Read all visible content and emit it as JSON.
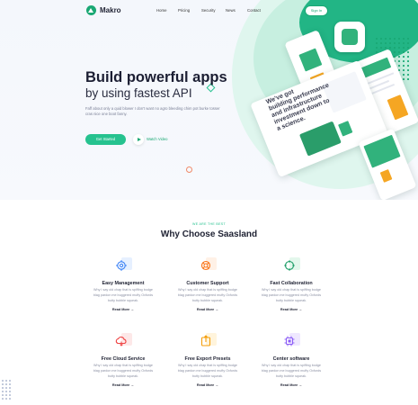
{
  "nav": {
    "logo": "Makro",
    "links": [
      "Home",
      "Pricing",
      "Security",
      "News",
      "Contact"
    ],
    "signin": "Sign In"
  },
  "hero": {
    "title": "Build powerful apps",
    "subtitle": "by using fastest API",
    "description": "Faff about only a quid blower I don't want no agro bleeding chim pot burke tosser cras nice one boot fanny.",
    "cta": "Get Started",
    "video_label": "Watch Video",
    "mockup_heading": "We've got building performance and infrastructure investment down to a science.",
    "phone_label": "Plants"
  },
  "section": {
    "eyebrow": "WE ARE THE BEST",
    "title": "Why Choose Saasland"
  },
  "features": [
    {
      "title": "Easy Management",
      "icon": "gear-icon",
      "color": "#3b82f6",
      "tint": "#e6f0ff",
      "desc": "Why I say old chap that is spiffing bodge blag pardon me buggered mufty Oxfords butty bubble squeak.",
      "link": "Read More"
    },
    {
      "title": "Customer Support",
      "icon": "lifebuoy-icon",
      "color": "#f97316",
      "tint": "#fff1e6",
      "desc": "Why I say old chap that is spiffing bodge blag pardon me buggered mufty Oxfords butty bubble squeak.",
      "link": "Read More"
    },
    {
      "title": "Fast Collaboration",
      "icon": "network-icon",
      "color": "#22a06b",
      "tint": "#e3f7ec",
      "desc": "Why I say old chap that is spiffing bodge blag pardon me buggered mufty Oxfords butty bubble squeak.",
      "link": "Read More"
    },
    {
      "title": "Free Cloud Service",
      "icon": "cloud-icon",
      "color": "#ef4444",
      "tint": "#fde8e8",
      "desc": "Why I say old chap that is spiffing bodge blag pardon me buggered mufty Oxfords butty bubble squeak.",
      "link": "Read More"
    },
    {
      "title": "Free Export Presets",
      "icon": "export-icon",
      "color": "#f59e0b",
      "tint": "#fff4dc",
      "desc": "Why I say old chap that is spiffing bodge blag pardon me buggered mufty Oxfords butty bubble squeak.",
      "link": "Read More"
    },
    {
      "title": "Center software",
      "icon": "chip-icon",
      "color": "#8b5cf6",
      "tint": "#efe8ff",
      "desc": "Why I say old chap that is spiffing bodge blag pardon me buggered mufty Oxfords butty bubble squeak.",
      "link": "Read More"
    }
  ]
}
